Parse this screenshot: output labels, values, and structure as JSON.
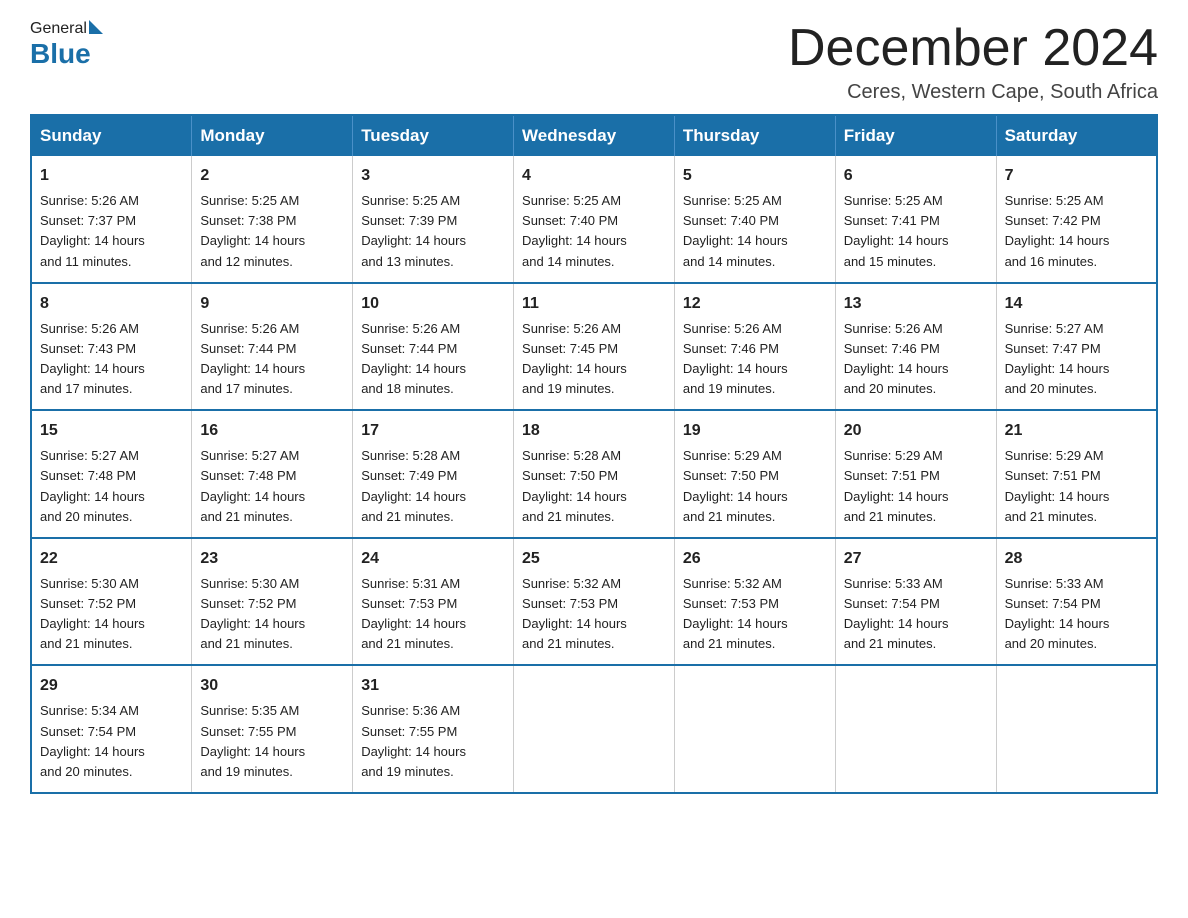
{
  "header": {
    "logo_general": "General",
    "logo_blue": "Blue",
    "month_year": "December 2024",
    "location": "Ceres, Western Cape, South Africa"
  },
  "weekdays": [
    "Sunday",
    "Monday",
    "Tuesday",
    "Wednesday",
    "Thursday",
    "Friday",
    "Saturday"
  ],
  "weeks": [
    [
      {
        "day": "1",
        "sunrise": "5:26 AM",
        "sunset": "7:37 PM",
        "daylight": "14 hours and 11 minutes."
      },
      {
        "day": "2",
        "sunrise": "5:25 AM",
        "sunset": "7:38 PM",
        "daylight": "14 hours and 12 minutes."
      },
      {
        "day": "3",
        "sunrise": "5:25 AM",
        "sunset": "7:39 PM",
        "daylight": "14 hours and 13 minutes."
      },
      {
        "day": "4",
        "sunrise": "5:25 AM",
        "sunset": "7:40 PM",
        "daylight": "14 hours and 14 minutes."
      },
      {
        "day": "5",
        "sunrise": "5:25 AM",
        "sunset": "7:40 PM",
        "daylight": "14 hours and 14 minutes."
      },
      {
        "day": "6",
        "sunrise": "5:25 AM",
        "sunset": "7:41 PM",
        "daylight": "14 hours and 15 minutes."
      },
      {
        "day": "7",
        "sunrise": "5:25 AM",
        "sunset": "7:42 PM",
        "daylight": "14 hours and 16 minutes."
      }
    ],
    [
      {
        "day": "8",
        "sunrise": "5:26 AM",
        "sunset": "7:43 PM",
        "daylight": "14 hours and 17 minutes."
      },
      {
        "day": "9",
        "sunrise": "5:26 AM",
        "sunset": "7:44 PM",
        "daylight": "14 hours and 17 minutes."
      },
      {
        "day": "10",
        "sunrise": "5:26 AM",
        "sunset": "7:44 PM",
        "daylight": "14 hours and 18 minutes."
      },
      {
        "day": "11",
        "sunrise": "5:26 AM",
        "sunset": "7:45 PM",
        "daylight": "14 hours and 19 minutes."
      },
      {
        "day": "12",
        "sunrise": "5:26 AM",
        "sunset": "7:46 PM",
        "daylight": "14 hours and 19 minutes."
      },
      {
        "day": "13",
        "sunrise": "5:26 AM",
        "sunset": "7:46 PM",
        "daylight": "14 hours and 20 minutes."
      },
      {
        "day": "14",
        "sunrise": "5:27 AM",
        "sunset": "7:47 PM",
        "daylight": "14 hours and 20 minutes."
      }
    ],
    [
      {
        "day": "15",
        "sunrise": "5:27 AM",
        "sunset": "7:48 PM",
        "daylight": "14 hours and 20 minutes."
      },
      {
        "day": "16",
        "sunrise": "5:27 AM",
        "sunset": "7:48 PM",
        "daylight": "14 hours and 21 minutes."
      },
      {
        "day": "17",
        "sunrise": "5:28 AM",
        "sunset": "7:49 PM",
        "daylight": "14 hours and 21 minutes."
      },
      {
        "day": "18",
        "sunrise": "5:28 AM",
        "sunset": "7:50 PM",
        "daylight": "14 hours and 21 minutes."
      },
      {
        "day": "19",
        "sunrise": "5:29 AM",
        "sunset": "7:50 PM",
        "daylight": "14 hours and 21 minutes."
      },
      {
        "day": "20",
        "sunrise": "5:29 AM",
        "sunset": "7:51 PM",
        "daylight": "14 hours and 21 minutes."
      },
      {
        "day": "21",
        "sunrise": "5:29 AM",
        "sunset": "7:51 PM",
        "daylight": "14 hours and 21 minutes."
      }
    ],
    [
      {
        "day": "22",
        "sunrise": "5:30 AM",
        "sunset": "7:52 PM",
        "daylight": "14 hours and 21 minutes."
      },
      {
        "day": "23",
        "sunrise": "5:30 AM",
        "sunset": "7:52 PM",
        "daylight": "14 hours and 21 minutes."
      },
      {
        "day": "24",
        "sunrise": "5:31 AM",
        "sunset": "7:53 PM",
        "daylight": "14 hours and 21 minutes."
      },
      {
        "day": "25",
        "sunrise": "5:32 AM",
        "sunset": "7:53 PM",
        "daylight": "14 hours and 21 minutes."
      },
      {
        "day": "26",
        "sunrise": "5:32 AM",
        "sunset": "7:53 PM",
        "daylight": "14 hours and 21 minutes."
      },
      {
        "day": "27",
        "sunrise": "5:33 AM",
        "sunset": "7:54 PM",
        "daylight": "14 hours and 21 minutes."
      },
      {
        "day": "28",
        "sunrise": "5:33 AM",
        "sunset": "7:54 PM",
        "daylight": "14 hours and 20 minutes."
      }
    ],
    [
      {
        "day": "29",
        "sunrise": "5:34 AM",
        "sunset": "7:54 PM",
        "daylight": "14 hours and 20 minutes."
      },
      {
        "day": "30",
        "sunrise": "5:35 AM",
        "sunset": "7:55 PM",
        "daylight": "14 hours and 19 minutes."
      },
      {
        "day": "31",
        "sunrise": "5:36 AM",
        "sunset": "7:55 PM",
        "daylight": "14 hours and 19 minutes."
      },
      null,
      null,
      null,
      null
    ]
  ],
  "labels": {
    "sunrise": "Sunrise:",
    "sunset": "Sunset:",
    "daylight": "Daylight:"
  }
}
